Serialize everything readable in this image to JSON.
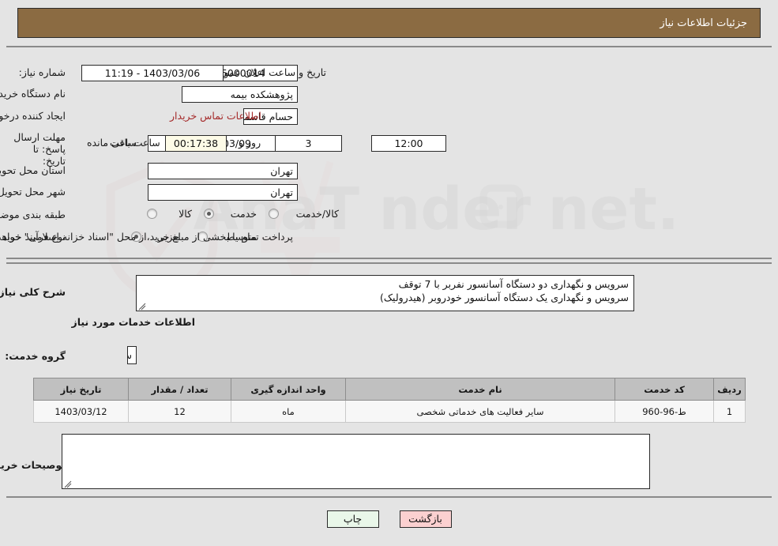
{
  "header": {
    "title": "جزئیات اطلاعات نیاز",
    "bg_color": "#8b6b42",
    "text_color": "#ffffff"
  },
  "form": {
    "need_number": {
      "label": "شماره نیاز:",
      "value": "1103003005000014"
    },
    "announce_datetime": {
      "label": "تاریخ و ساعت اعلان عمومی:",
      "value": "11:19 - 1403/03/06"
    },
    "buyer_org": {
      "label": "نام دستگاه خریدار:",
      "value": "پژوهشکده بیمه"
    },
    "request_creator": {
      "label": "ایجاد کننده درخواست:",
      "value": "حسام قاسمیان مقدم مسئول امور عمومی پژوهشکده بیمه"
    },
    "buyer_contact_link": {
      "label": "اطلاعات تماس خریدار",
      "color": "#a52a2a"
    },
    "response_deadline": {
      "label": "مهلت ارسال پاسخ: تا تاریخ:",
      "date": "1403/03/09",
      "hour_label": "ساعت",
      "hour": "12:00",
      "days": "3",
      "days_suffix": "روز و",
      "remaining": "00:17:38",
      "remaining_suffix": "ساعت باقی مانده"
    },
    "delivery_province": {
      "label": "استان محل تحویل:",
      "value": "تهران"
    },
    "delivery_city": {
      "label": "شهر محل تحویل:",
      "value": "تهران"
    },
    "subject_classification": {
      "label": "طبقه بندی موضوعی:",
      "options": [
        "کالا",
        "خدمت",
        "کالا/خدمت"
      ],
      "selected": "خدمت"
    },
    "purchase_type": {
      "label": "نوع فرآیند خرید :",
      "options": [
        "جزیی",
        "متوسط"
      ],
      "selected": "جزیی",
      "note": "پرداخت تمام یا بخشی از مبلغ خرید،از محل \"اسناد خزانه اسلامی\" خواهد بود."
    }
  },
  "description": {
    "label": "شرح کلی نیاز:",
    "value": "سرویس و نگهداری دو دستگاه آسانسور نفربر با 7 توقف\nسرویس و نگهداری یک دستگاه آسانسور خودروبر (هیدرولیک)"
  },
  "services_section": {
    "heading": "اطلاعات خدمات مورد نیاز",
    "service_group": {
      "label": "گروه خدمت:",
      "value": "سایر فعالیت‌های خدماتی"
    }
  },
  "table": {
    "columns": [
      "ردیف",
      "کد خدمت",
      "نام خدمت",
      "واحد اندازه گیری",
      "تعداد / مقدار",
      "تاریخ نیاز"
    ],
    "rows": [
      {
        "row": "1",
        "service_code": "ط-96-960",
        "service_name": "سایر فعالیت های خدماتی شخصی",
        "unit": "ماه",
        "quantity": "12",
        "need_date": "1403/03/12"
      }
    ]
  },
  "buyer_comments": {
    "label": "توصیحات خریدار:",
    "value": ""
  },
  "buttons": {
    "print": "چاپ",
    "back": "بازگشت"
  }
}
